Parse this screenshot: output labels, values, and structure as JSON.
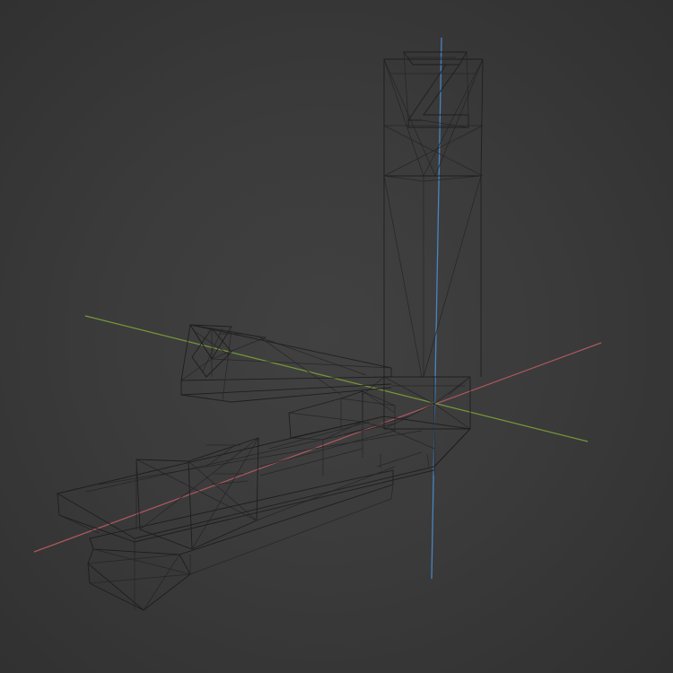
{
  "viewport": {
    "background_color": "#3a3a3a",
    "axes": {
      "x_color": "#b45a62",
      "y_color": "#7a9e3a",
      "z_color": "#4a88c7"
    },
    "wire_color": "#1c1c1c"
  }
}
